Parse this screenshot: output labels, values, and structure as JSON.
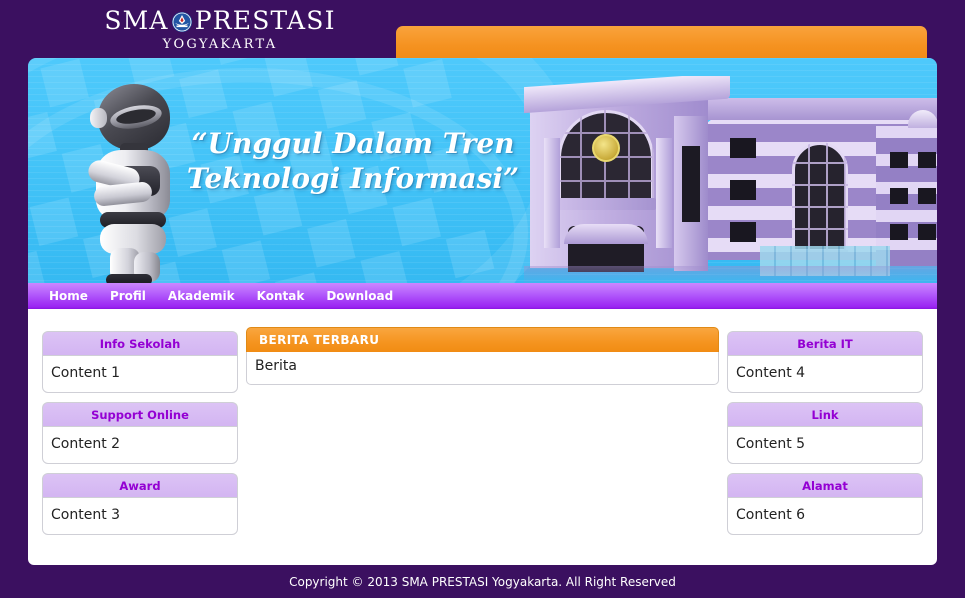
{
  "site": {
    "brand_line1_before": "SMA",
    "brand_emblem_icon": "tut-wuri-handayani-emblem",
    "brand_line1_after": "PRESTASI",
    "brand_line2": "YOGYAKARTA",
    "background_color": "#3b1060",
    "accent_orange": "#f5941f",
    "accent_purple": "#9400d3",
    "banner_blue": "#44c4f8"
  },
  "banner": {
    "headline_line1": "“Unggul Dalam Tren",
    "headline_line2": "Teknologi Informasi”",
    "robot_icon": "robot-mascot",
    "building_icon": "school-building"
  },
  "nav": {
    "items": [
      {
        "label": "Home"
      },
      {
        "label": "Profil"
      },
      {
        "label": "Akademik"
      },
      {
        "label": "Kontak"
      },
      {
        "label": "Download"
      }
    ]
  },
  "left_widgets": [
    {
      "title": "Info Sekolah",
      "body": "Content 1"
    },
    {
      "title": "Support Online",
      "body": "Content 2"
    },
    {
      "title": "Award",
      "body": "Content 3"
    }
  ],
  "right_widgets": [
    {
      "title": "Berita IT",
      "body": "Content 4"
    },
    {
      "title": "Link",
      "body": "Content 5"
    },
    {
      "title": "Alamat",
      "body": "Content 6"
    }
  ],
  "main_panel": {
    "title": "BERITA TERBARU",
    "body": "Berita"
  },
  "footer": {
    "copyright": "Copyright © 2013 SMA PRESTASI Yogyakarta. All Right Reserved"
  }
}
